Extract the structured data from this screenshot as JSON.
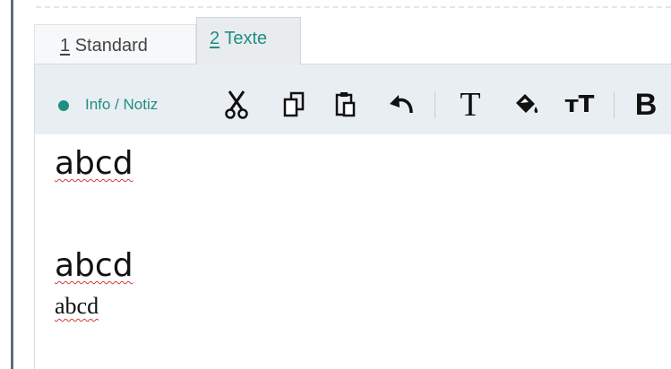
{
  "tabs": [
    {
      "number": "1",
      "label": "Standard"
    },
    {
      "number": "2",
      "label": "Texte"
    }
  ],
  "toolbar": {
    "info_label": "Info / Notiz",
    "accent_color": "#1f8f83",
    "tools": [
      "scissors-icon",
      "copy-icon",
      "paste-icon",
      "undo-icon",
      "text-icon",
      "fill-color-icon",
      "font-size-icon",
      "bold-icon"
    ],
    "text_glyph": "T",
    "font_size_glyph": "ᴛT",
    "bold_glyph": "B"
  },
  "editor": {
    "lines": [
      "abcd",
      "abcd",
      "abcd"
    ]
  }
}
